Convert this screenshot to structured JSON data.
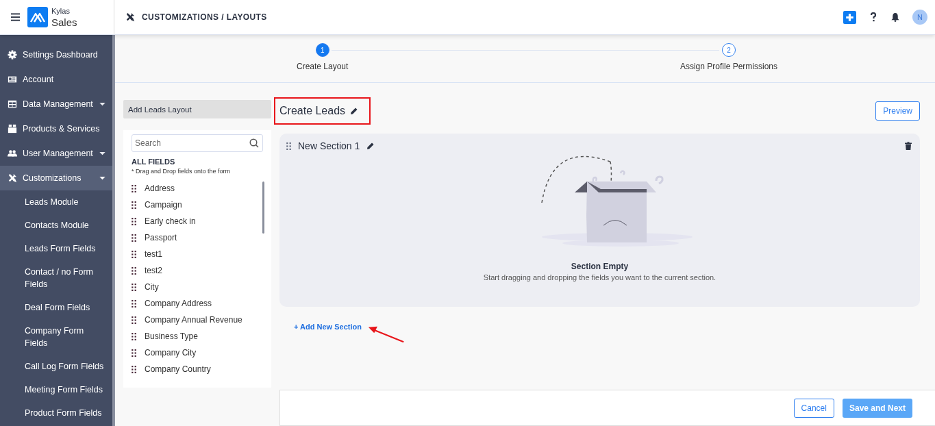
{
  "brand": {
    "top": "Kylas",
    "bottom": "Sales"
  },
  "breadcrumb": "CUSTOMIZATIONS / LAYOUTS",
  "user": {
    "initial": "N"
  },
  "sidebar": {
    "items": [
      {
        "label": "Settings Dashboard",
        "selected": false
      },
      {
        "label": "Account",
        "selected": false
      },
      {
        "label": "Data Management",
        "selected": false,
        "expanded": false
      },
      {
        "label": "Products & Services",
        "selected": false
      },
      {
        "label": "User Management",
        "selected": false,
        "expanded": false
      },
      {
        "label": "Customizations",
        "selected": true,
        "expanded": true,
        "children": [
          {
            "label": "Leads Module"
          },
          {
            "label": "Contacts Module"
          },
          {
            "label": "Leads Form Fields"
          },
          {
            "label": "Contact / no Form Fields"
          },
          {
            "label": "Deal Form Fields"
          },
          {
            "label": "Company Form Fields"
          },
          {
            "label": "Call Log Form Fields"
          },
          {
            "label": "Meeting Form Fields"
          },
          {
            "label": "Product Form Fields"
          }
        ]
      }
    ]
  },
  "steps": [
    {
      "number": "1",
      "label": "Create Layout",
      "selected": true
    },
    {
      "number": "2",
      "label": "Assign Profile Permissions",
      "selected": false
    }
  ],
  "fields_panel": {
    "header": "Add Leads Layout",
    "search": {
      "placeholder": "Search"
    },
    "title": "ALL FIELDS",
    "hint": "* Drag and Drop fields onto the form",
    "fields": [
      "Address",
      "Campaign",
      "Early check in",
      "Passport",
      "test1",
      "test2",
      "City",
      "Company Address",
      "Company Annual Revenue",
      "Business Type",
      "Company City",
      "Company Country"
    ]
  },
  "layout": {
    "title": "Create Leads",
    "preview": "Preview",
    "sections": [
      {
        "title": "New Section 1",
        "empty_title": "Section Empty",
        "empty_text": "Start dragging and dropping the fields you want to the current section."
      }
    ],
    "add_section": "+ Add New Section"
  },
  "footer": {
    "cancel": "Cancel",
    "save": {
      "label": "Save and Next",
      "disabled": true
    }
  }
}
